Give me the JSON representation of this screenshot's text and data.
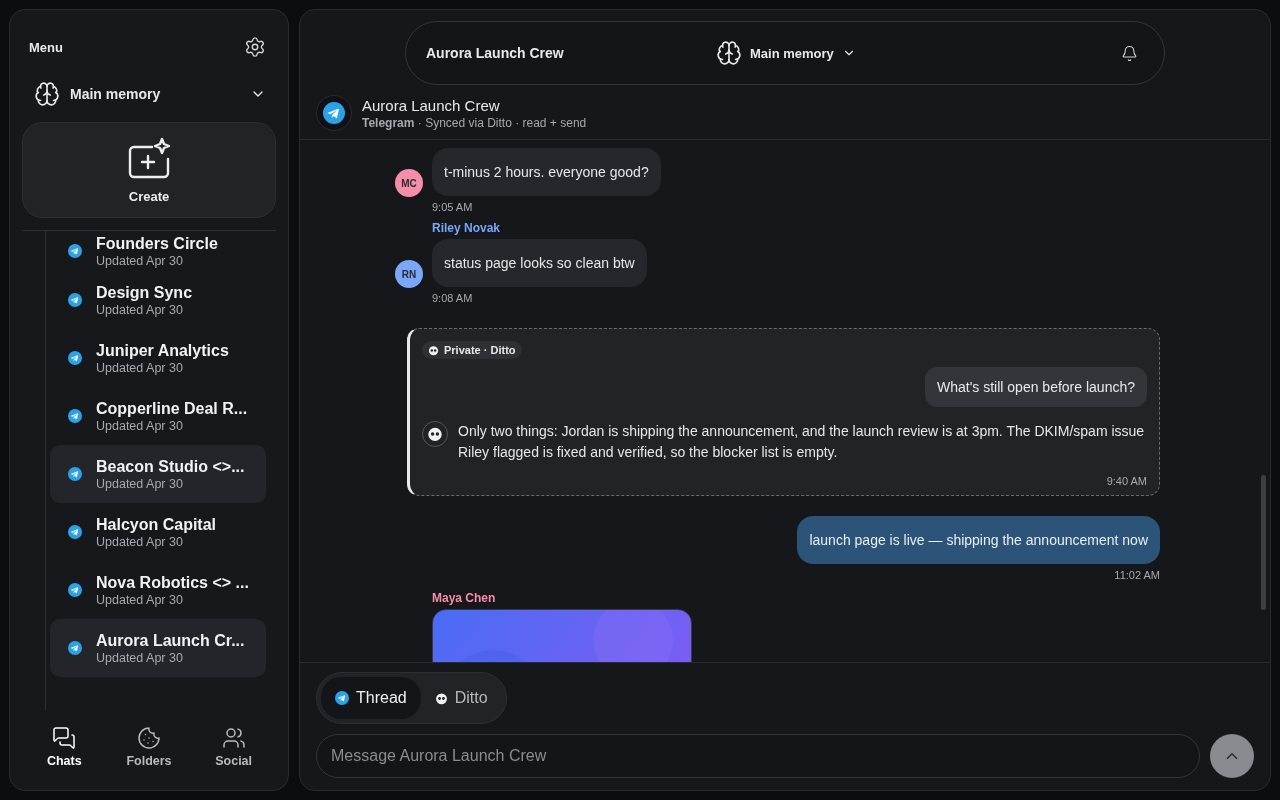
{
  "sidebar": {
    "title": "Menu",
    "memory": {
      "label": "Main memory"
    },
    "create": {
      "label": "Create"
    },
    "chats": [
      {
        "name": "Founders Circle",
        "updated": "Updated Apr 30",
        "highlighted": false
      },
      {
        "name": "Design Sync",
        "updated": "Updated Apr 30",
        "highlighted": false
      },
      {
        "name": "Juniper Analytics",
        "updated": "Updated Apr 30",
        "highlighted": false
      },
      {
        "name": "Copperline Deal R...",
        "updated": "Updated Apr 30",
        "highlighted": false
      },
      {
        "name": "Beacon Studio <>...",
        "updated": "Updated Apr 30",
        "highlighted": true
      },
      {
        "name": "Halcyon Capital",
        "updated": "Updated Apr 30",
        "highlighted": false
      },
      {
        "name": "Nova Robotics <> ...",
        "updated": "Updated Apr 30",
        "highlighted": false
      },
      {
        "name": "Aurora Launch Cr...",
        "updated": "Updated Apr 30",
        "highlighted": true
      }
    ],
    "nav": [
      {
        "label": "Chats",
        "selected": true
      },
      {
        "label": "Folders",
        "selected": false
      },
      {
        "label": "Social",
        "selected": false
      }
    ]
  },
  "topbar": {
    "title": "Aurora Launch Crew",
    "memory": "Main memory"
  },
  "chat_header": {
    "title": "Aurora Launch Crew",
    "platform": "Telegram",
    "status": "· Synced via Ditto · read + send"
  },
  "messages": [
    {
      "kind": "incoming",
      "text": "t-minus 2 hours. everyone good?",
      "time": "9:05 AM",
      "initials": "MC",
      "color": "#f58ea8"
    },
    {
      "kind": "incoming",
      "sender": "Riley Novak",
      "text": "status page looks so clean btw",
      "time": "9:08 AM",
      "initials": "RN",
      "color": "#7aa7f7"
    },
    {
      "kind": "private",
      "badge": "Private · Ditto",
      "question": "What's still open before launch?",
      "answer": "Only two things: Jordan is shipping the announcement, and the launch review is at 3pm. The DKIM/spam issue Riley flagged is fixed and verified, so the blocker list is empty.",
      "time": "9:40 AM"
    },
    {
      "kind": "outgoing",
      "text": "launch page is live — shipping the announcement now",
      "time": "11:02 AM"
    },
    {
      "sender": "Maya Chen",
      "color": "#f58ea8"
    }
  ],
  "composer": {
    "modes": [
      {
        "label": "Thread",
        "selected": true
      },
      {
        "label": "Ditto",
        "selected": false
      }
    ],
    "placeholder": "Message Aurora Launch Crew"
  }
}
